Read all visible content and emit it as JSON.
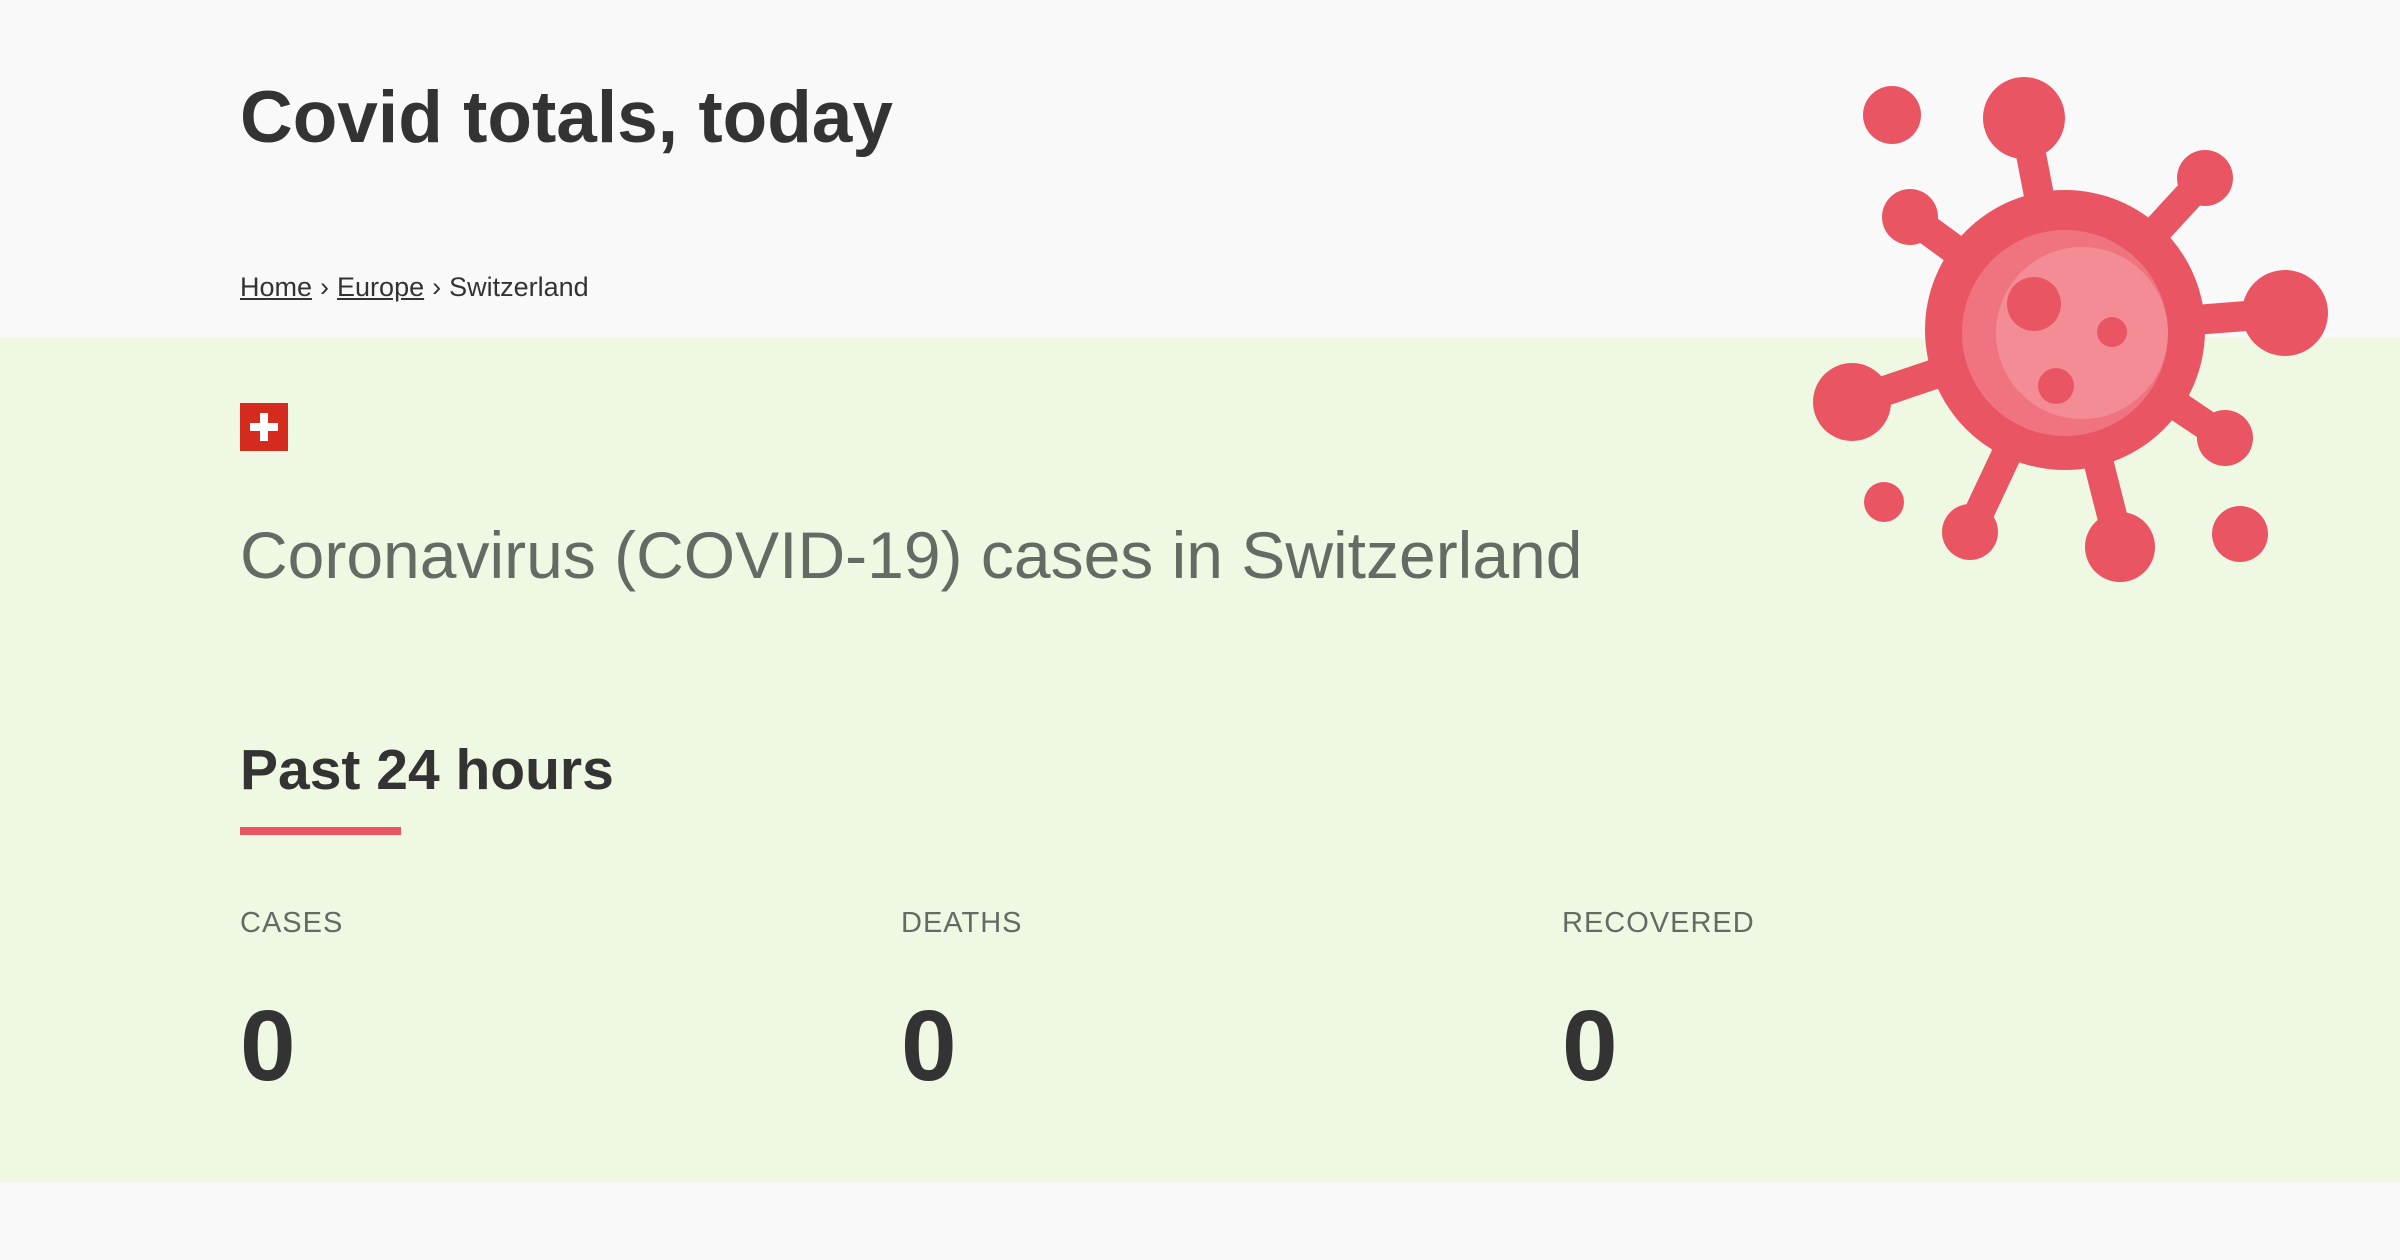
{
  "header": {
    "title": "Covid totals, today",
    "breadcrumb": {
      "home": "Home",
      "region": "Europe",
      "separator": "›",
      "current": "Switzerland"
    }
  },
  "main": {
    "flag_icon": "swiss-flag-icon",
    "heading": "Coronavirus (COVID-19) cases in Switzerland",
    "section": {
      "title": "Past 24 hours",
      "accent_color": "#ea5564"
    },
    "stats": [
      {
        "label": "CASES",
        "value": "0"
      },
      {
        "label": "DEATHS",
        "value": "0"
      },
      {
        "label": "RECOVERED",
        "value": "0"
      }
    ]
  },
  "illustration": {
    "icon": "virus-icon",
    "color": "#ea5564"
  },
  "colors": {
    "page_background": "#f9f9f9",
    "main_background": "#eff8e2",
    "text": "#333333",
    "muted_text": "#646a64"
  }
}
